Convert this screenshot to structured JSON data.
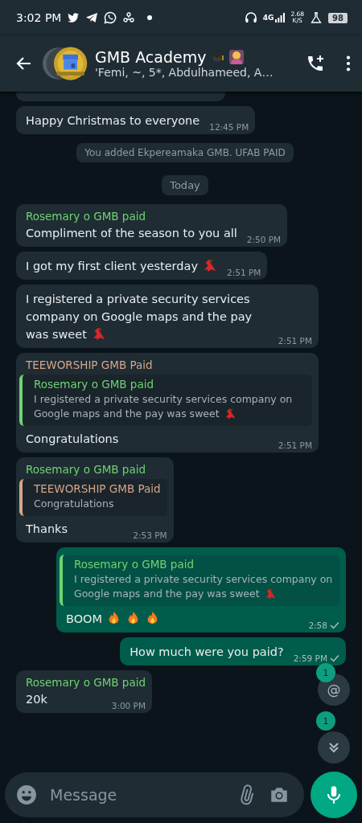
{
  "status_bar": {
    "time": "3:02 PM",
    "network": "4G",
    "speed": "2.68",
    "speed_unit": "K/S",
    "battery": "98"
  },
  "header": {
    "title": "GMB Academy",
    "subtitle": "'Femi, ~, 5*, Abdulhameed, A…"
  },
  "messages": [
    {
      "kind": "clipped"
    },
    {
      "kind": "incoming",
      "text": "Happy Christmas to everyone",
      "time": "12:45 PM"
    },
    {
      "kind": "system",
      "text": "You added Ekpereamaka GMB. UFAB PAID"
    },
    {
      "kind": "date",
      "text": "Today"
    },
    {
      "kind": "incoming",
      "sender": {
        "name": "Rosemary o GMB paid",
        "color": "#6fd371"
      },
      "text": "Compliment of the season to you all",
      "time": "2:50 PM"
    },
    {
      "kind": "incoming",
      "text": "I got my first client yesterday",
      "emoji": [
        {
          "kind": "dancer"
        }
      ],
      "time": "2:51 PM"
    },
    {
      "kind": "incoming",
      "text": "I registered a private security services company on Google maps and the pay was sweet",
      "emoji": [
        {
          "kind": "dancer"
        }
      ],
      "time": "2:51 PM"
    },
    {
      "kind": "incoming",
      "sender": {
        "name": "TEEWORSHIP GMB Paid",
        "color": "#d5a68a"
      },
      "quote": {
        "sender": "Rosemary o GMB paid",
        "color": "#6fd371",
        "text": "I registered a private security services company on Google maps and the pay was sweet",
        "emoji": [
          {
            "kind": "dancer"
          }
        ]
      },
      "text": "Congratulations",
      "time": "2:51 PM"
    },
    {
      "kind": "incoming",
      "sender": {
        "name": "Rosemary o GMB paid",
        "color": "#6fd371"
      },
      "quote": {
        "sender": "TEEWORSHIP GMB Paid",
        "color": "#d5a68a",
        "text": "Congratulations"
      },
      "text": "Thanks",
      "time": "2:53 PM"
    },
    {
      "kind": "outgoing",
      "quote": {
        "sender": "Rosemary o GMB paid",
        "color": "#6fd371",
        "text": "I registered a private security services company on Google maps and the pay was sweet",
        "emoji": [
          {
            "kind": "dancer"
          }
        ]
      },
      "text": "BOOM",
      "emoji": [
        {
          "kind": "fire"
        },
        {
          "kind": "fire"
        },
        {
          "kind": "fire"
        }
      ],
      "time": "2:58",
      "delivered": false
    },
    {
      "kind": "outgoing",
      "text": "How much were you paid?",
      "time": "2:59 PM",
      "delivered": false
    },
    {
      "kind": "incoming",
      "sender": {
        "name": "Rosemary o GMB paid",
        "color": "#6fd371"
      },
      "text": "20k",
      "time": "3:00 PM"
    }
  ],
  "badges": [
    {
      "text": "1"
    },
    {
      "text": "1"
    }
  ],
  "mention_button": {
    "text": "@"
  },
  "composer": {
    "placeholder": "Message"
  }
}
